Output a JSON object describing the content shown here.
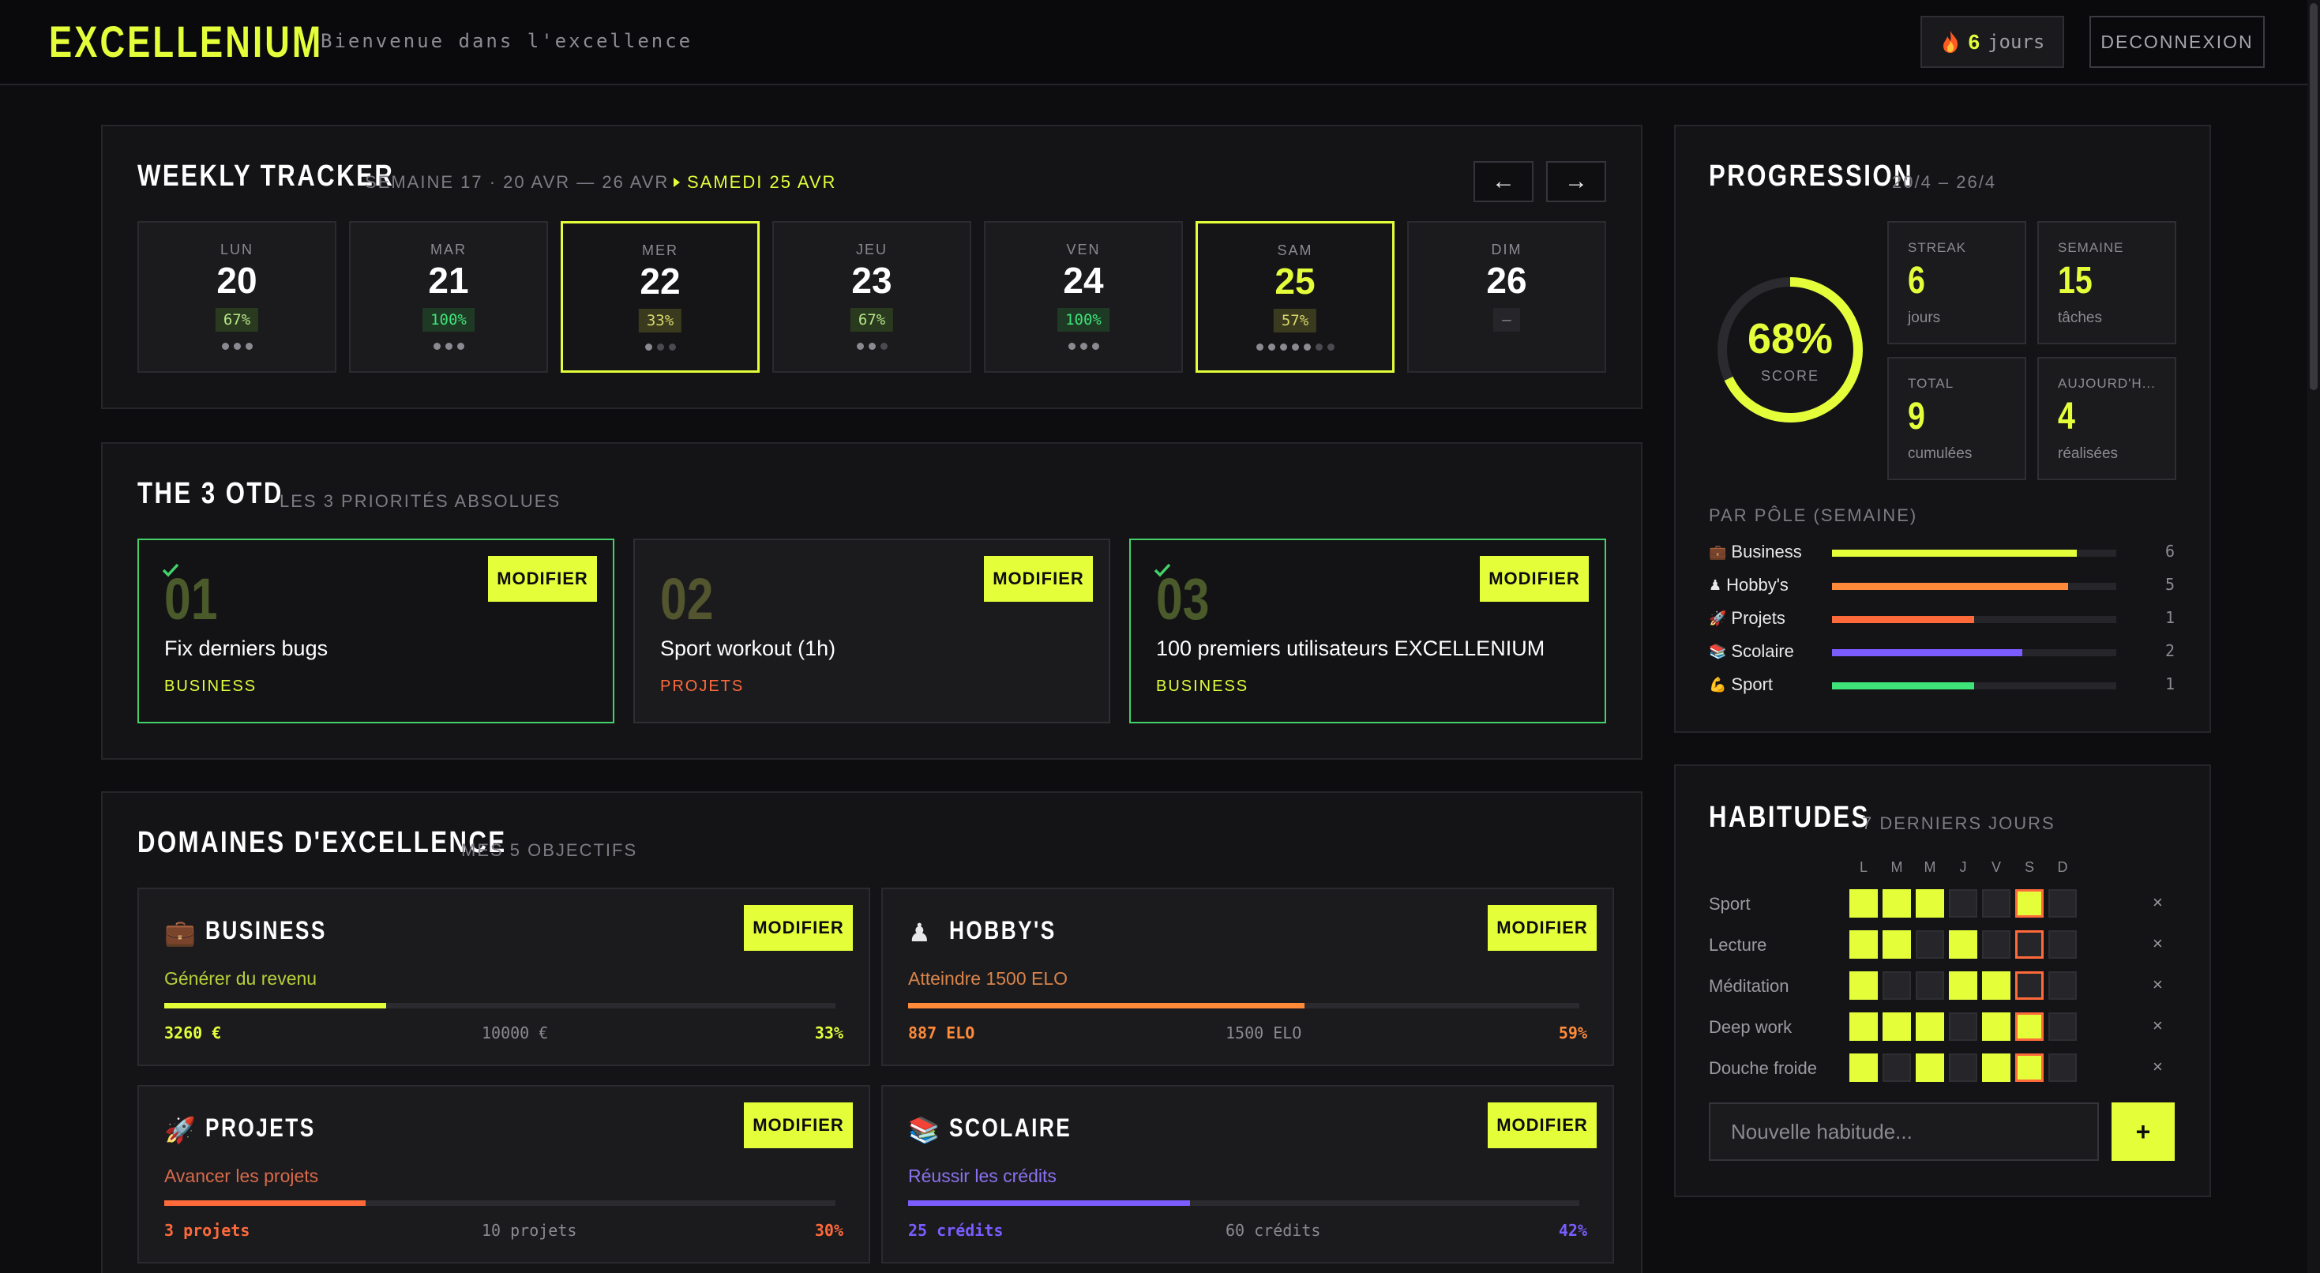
{
  "header": {
    "logo": "EXCELLENIUM",
    "tagline": "Bienvenue dans l'excellence",
    "streak_num": "6",
    "streak_unit": "jours",
    "logout_label": "DECONNEXION"
  },
  "weekly": {
    "title": "WEEKLY TRACKER",
    "week_range": "SEMAINE 17 · 20 AVR — 26 AVR",
    "today_label": "SAMEDI 25 AVR",
    "prev_label": "←",
    "next_label": "→",
    "days": [
      {
        "name": "LUN",
        "num": "20",
        "pct": "67%",
        "dots_total": 3,
        "dots_done": 3
      },
      {
        "name": "MAR",
        "num": "21",
        "pct": "100%",
        "dots_total": 3,
        "dots_done": 3
      },
      {
        "name": "MER",
        "num": "22",
        "pct": "33%",
        "dots_total": 3,
        "dots_done": 1
      },
      {
        "name": "JEU",
        "num": "23",
        "pct": "67%",
        "dots_total": 3,
        "dots_done": 2
      },
      {
        "name": "VEN",
        "num": "24",
        "pct": "100%",
        "dots_total": 3,
        "dots_done": 3
      },
      {
        "name": "SAM",
        "num": "25",
        "pct": "57%",
        "dots_total": 7,
        "dots_done": 5
      },
      {
        "name": "DIM",
        "num": "26",
        "pct": "–",
        "dots_total": 0,
        "dots_done": 0
      }
    ]
  },
  "otd": {
    "title": "THE 3 OTD",
    "subtitle": "LES 3 PRIORITÉS ABSOLUES",
    "items": [
      {
        "num": "01",
        "text": "Fix derniers bugs",
        "category": "BUSINESS",
        "cat_color": "#e4ff3a",
        "done": true,
        "action": "MODIFIER"
      },
      {
        "num": "02",
        "text": "Sport workout (1h)",
        "category": "PROJETS",
        "cat_color": "#ff6a3a",
        "done": false,
        "action": "MODIFIER"
      },
      {
        "num": "03",
        "text": "100 premiers utilisateurs EXCELLENIUM",
        "category": "BUSINESS",
        "cat_color": "#e4ff3a",
        "done": true,
        "action": "MODIFIER"
      }
    ]
  },
  "domains": {
    "title": "DOMAINES D'EXCELLENCE",
    "subtitle": "MES 5 OBJECTIFS",
    "items": [
      {
        "icon": "💼",
        "name": "BUSINESS",
        "goal": "Générer du revenu",
        "current": "3260 €",
        "target": "10000 €",
        "pct": "33%",
        "progress": 0.33,
        "color": "#e4ff3a",
        "goal_color": "#b8cf3a",
        "action": "MODIFIER"
      },
      {
        "icon": "♟",
        "name": "HOBBY'S",
        "goal": "Atteindre 1500 ELO",
        "current": "887 ELO",
        "target": "1500 ELO",
        "pct": "59%",
        "progress": 0.59,
        "color": "#ff8a3a",
        "goal_color": "#d8844a",
        "action": "MODIFIER"
      },
      {
        "icon": "🚀",
        "name": "PROJETS",
        "goal": "Avancer les projets",
        "current": "3 projets",
        "target": "10 projets",
        "pct": "30%",
        "progress": 0.3,
        "color": "#ff6a3a",
        "goal_color": "#d86a4a",
        "action": "MODIFIER"
      },
      {
        "icon": "📚",
        "name": "SCOLAIRE",
        "goal": "Réussir les crédits",
        "current": "25 crédits",
        "target": "60 crédits",
        "pct": "42%",
        "progress": 0.42,
        "color": "#7a5cff",
        "goal_color": "#8a72ee",
        "action": "MODIFIER"
      }
    ]
  },
  "progression": {
    "title": "PROGRESSION",
    "range": "20/4 – 26/4",
    "score": "68%",
    "score_label": "SCORE",
    "score_value": 0.68,
    "stats": [
      {
        "label": "STREAK",
        "value": "6",
        "unit": "jours"
      },
      {
        "label": "SEMAINE",
        "value": "15",
        "unit": "tâches"
      },
      {
        "label": "TOTAL",
        "value": "9",
        "unit": "cumulées"
      },
      {
        "label": "AUJOURD'H...",
        "value": "4",
        "unit": "réalisées"
      }
    ],
    "poles_title": "PAR PÔLE (SEMAINE)",
    "poles": [
      {
        "icon": "💼",
        "name": "Business",
        "count": "6",
        "progress": 0.86,
        "color": "#e4ff3a"
      },
      {
        "icon": "♟",
        "name": "Hobby's",
        "count": "5",
        "progress": 0.83,
        "color": "#ff8a3a"
      },
      {
        "icon": "🚀",
        "name": "Projets",
        "count": "1",
        "progress": 0.5,
        "color": "#ff6a3a"
      },
      {
        "icon": "📚",
        "name": "Scolaire",
        "count": "2",
        "progress": 0.67,
        "color": "#7a5cff"
      },
      {
        "icon": "💪",
        "name": "Sport",
        "count": "1",
        "progress": 0.5,
        "color": "#3ee37a"
      }
    ]
  },
  "habits": {
    "title": "HABITUDES",
    "subtitle": "7 DERNIERS JOURS",
    "days": [
      "L",
      "M",
      "M",
      "J",
      "V",
      "S",
      "D"
    ],
    "rows": [
      {
        "name": "Sport",
        "cells": [
          1,
          1,
          1,
          0,
          0,
          1,
          0
        ]
      },
      {
        "name": "Lecture",
        "cells": [
          1,
          1,
          0,
          1,
          0,
          0,
          0
        ]
      },
      {
        "name": "Méditation",
        "cells": [
          1,
          0,
          0,
          1,
          1,
          0,
          0
        ]
      },
      {
        "name": "Deep work",
        "cells": [
          1,
          1,
          1,
          0,
          1,
          1,
          0
        ]
      },
      {
        "name": "Douche froide",
        "cells": [
          1,
          0,
          1,
          0,
          1,
          1,
          0
        ]
      }
    ],
    "today_index": 5,
    "remove_label": "×",
    "input_placeholder": "Nouvelle habitude...",
    "add_label": "+"
  }
}
